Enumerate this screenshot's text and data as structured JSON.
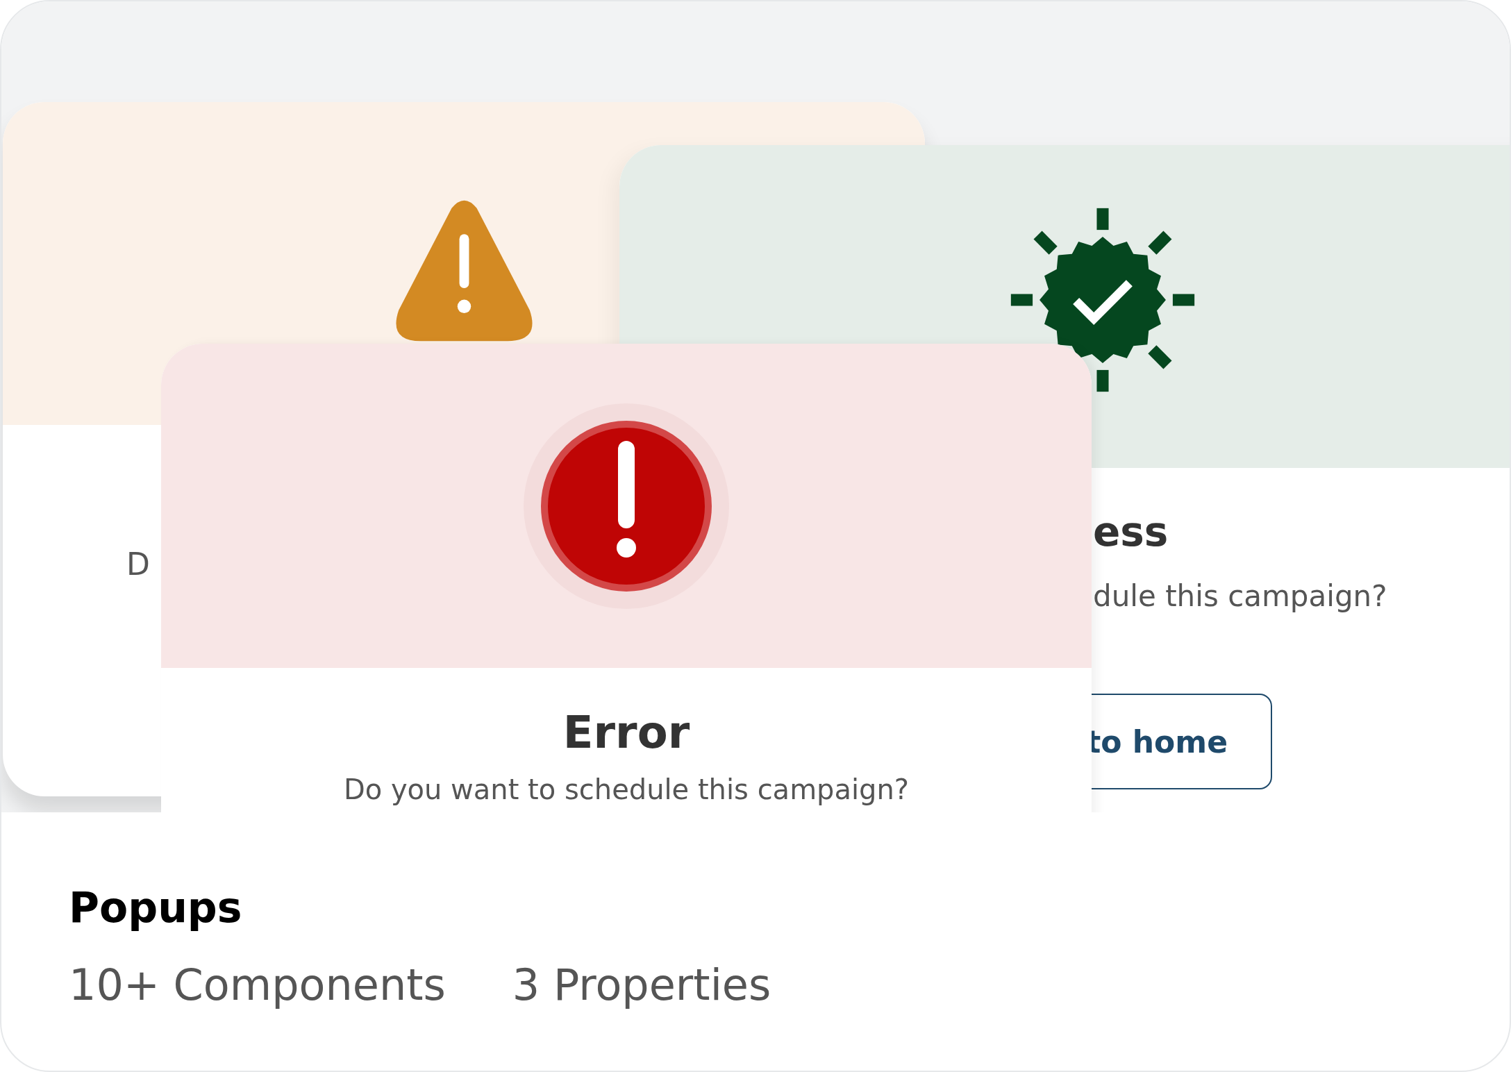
{
  "popups": [
    {
      "kind": "warning",
      "text": "D"
    },
    {
      "kind": "success",
      "title": "ess",
      "text": "dule this campaign?",
      "button": "to home"
    },
    {
      "kind": "error",
      "title": "Error",
      "text": "Do you want to schedule this campaign?"
    }
  ],
  "title": "Popups",
  "stats": [
    "10+ Components",
    "3 Properties"
  ]
}
